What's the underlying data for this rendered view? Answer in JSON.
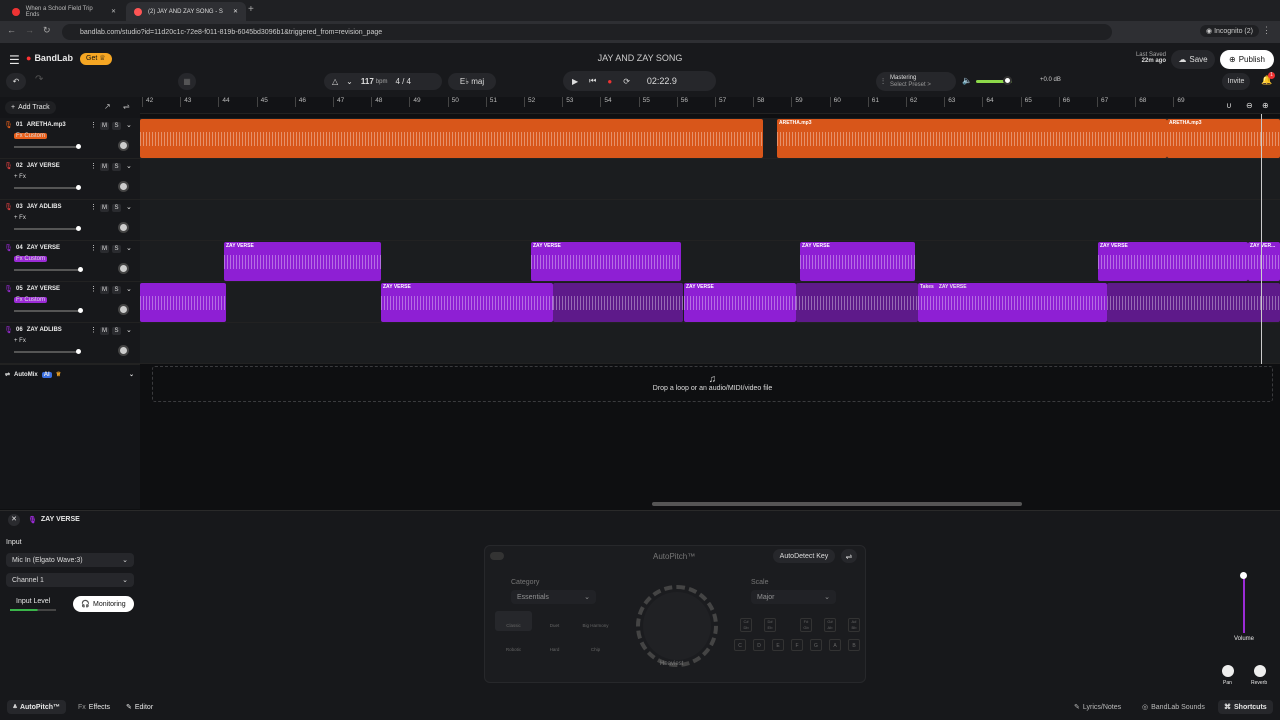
{
  "browser": {
    "tabs": [
      {
        "label": "When a School Field Trip Ends"
      },
      {
        "label": "(2) JAY AND ZAY SONG - S"
      }
    ],
    "url": "bandlab.com/studio?id=11d20c1c-72e8-f011-819b-6045bd3096b1&triggered_from=revision_page",
    "profile": "Incognito (2)"
  },
  "app": {
    "brand": "BandLab",
    "get_label": "Get",
    "project_title": "JAY AND ZAY SONG",
    "last_saved_label": "Last Saved",
    "last_saved_value": "22m ago",
    "save_label": "Save",
    "publish_label": "Publish",
    "invite_label": "Invite",
    "notif_count": "1"
  },
  "transport": {
    "bpm": "117",
    "bpm_unit": "bpm",
    "time_sig": "4 / 4",
    "key": "E♭ maj",
    "time": "02:22.9",
    "mastering_title": "Mastering",
    "mastering_sub": "Select Preset >",
    "gain": "+0.0 dB"
  },
  "add_track_label": "Add Track",
  "ruler": [
    "42",
    "43",
    "44",
    "45",
    "46",
    "47",
    "48",
    "49",
    "50",
    "51",
    "52",
    "53",
    "54",
    "55",
    "56",
    "57",
    "58",
    "59",
    "60",
    "61",
    "62",
    "63",
    "64",
    "65",
    "66",
    "67",
    "68",
    "69"
  ],
  "tracks": [
    {
      "num": "01",
      "name": "ARETHA.mp3",
      "fx": "Fx Custom",
      "color": "#e8601c",
      "vol": 0.97
    },
    {
      "num": "02",
      "name": "JAY VERSE",
      "fx": "+ Fx",
      "color": "#e04040",
      "vol": 0.97
    },
    {
      "num": "03",
      "name": "JAY ADLIBS",
      "fx": "+ Fx",
      "color": "#e04040",
      "vol": 0.97
    },
    {
      "num": "04",
      "name": "ZAY VERSE",
      "fx": "Fx Custom",
      "color": "#9b2bd6",
      "vol": 1.0
    },
    {
      "num": "05",
      "name": "ZAY VERSE",
      "fx": "Fx Custom",
      "color": "#9b2bd6",
      "vol": 1.0
    },
    {
      "num": "06",
      "name": "ZAY ADLIBS",
      "fx": "+ Fx",
      "color": "#9b2bd6",
      "vol": 0.97
    }
  ],
  "clips": {
    "orange_label": "ARETHA.mp3",
    "zay_label": "ZAY VERSE",
    "zay_label_trunc": "ZAY VER...",
    "takes_label": "Takes"
  },
  "automix": {
    "label": "AutoMix",
    "badge": "AI"
  },
  "drop_text": "Drop a loop or an audio/MIDI/video file",
  "editor": {
    "track_name": "ZAY VERSE",
    "input_label": "Input",
    "mic": "Mic In (Elgato Wave:3)",
    "channel": "Channel 1",
    "input_level_label": "Input Level",
    "monitoring_label": "Monitoring",
    "autopitch_title": "AutoPitch™",
    "autodetect_label": "AutoDetect Key",
    "category_label": "Category",
    "category_value": "Essentials",
    "scale_label": "Scale",
    "scale_value": "Major",
    "presets": [
      "Classic",
      "Duet",
      "Big Harmony",
      "Robotic",
      "Hard",
      "Chip"
    ],
    "knob_label": "Heaviest",
    "keys_top": [
      "C#\nDb",
      "D#\nEb",
      "F#\nGb",
      "G#\nAb",
      "A#\nBb"
    ],
    "keys_bottom": [
      "C",
      "D",
      "E",
      "F",
      "G",
      "A",
      "B"
    ],
    "volume_label": "Volume",
    "pan_label": "Pan",
    "reverb_label": "Reverb"
  },
  "bottom_tabs": {
    "autopitch": "AutoPitch™",
    "effects": "Effects",
    "editor": "Editor",
    "lyrics": "Lyrics/Notes",
    "sounds": "BandLab Sounds",
    "shortcuts": "Shortcuts"
  }
}
